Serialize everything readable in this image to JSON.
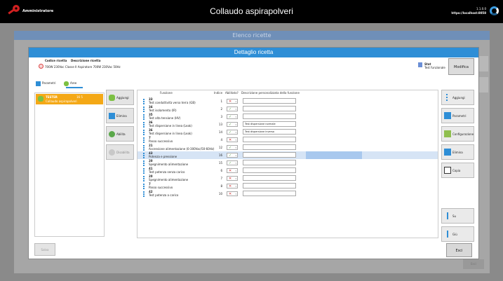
{
  "topbar": {
    "user": "Amministratore",
    "title": "Collaudo aspirapolveri",
    "version": "1.1.0.0",
    "host": "https://localhost:8058"
  },
  "background": {
    "title": "Elenco ricette",
    "footer_button": "Esci"
  },
  "dialog": {
    "title": "Dettaglio ricetta",
    "code_label": "Codice ricetta",
    "desc_label": "Descrizione ricetta",
    "recipe_value": "700W 230Vac Classe II Aspiratore 700W 230Vac 50Hz",
    "status_title": "Stat",
    "status_value": "Test funzionale",
    "modify_button": "Modifica",
    "save_button": "Salva",
    "exit_button": "Esci"
  },
  "tabs": [
    {
      "label": "Parametri"
    },
    {
      "label": "Aree"
    }
  ],
  "area": {
    "name": "TESTER",
    "meta": "16 5",
    "category": "Collaudo aspirapolveri"
  },
  "mid_buttons": [
    {
      "label": "Aggiungi"
    },
    {
      "label": "Elimina"
    },
    {
      "label": "Abilita"
    },
    {
      "label": "Disabilita"
    }
  ],
  "grid": {
    "headers": {
      "funzione": "Funzione",
      "indice": "Indice",
      "abilitato": "Abilitato?",
      "descrizione": "Descrizione personalizzata della funzione"
    },
    "rows": [
      {
        "num": "33",
        "fn": "Test conduttività verso terra (GB)",
        "idx": "1",
        "enabled": false,
        "desc": ""
      },
      {
        "num": "34",
        "fn": "Test isolamento (IR)",
        "idx": "2",
        "enabled": true,
        "desc": ""
      },
      {
        "num": "35",
        "fn": "Test alta tensione (HV)",
        "idx": "3",
        "enabled": true,
        "desc": ""
      },
      {
        "num": "36",
        "fn": "Test dispersione in linea (Leak)",
        "idx": "13",
        "enabled": true,
        "desc": "Test dispersione normale"
      },
      {
        "num": "36",
        "fn": "Test dispersione in linea (Leak)",
        "idx": "14",
        "enabled": true,
        "desc": "Test dispersione inverso"
      },
      {
        "num": "7",
        "fn": "Passo successivo",
        "idx": "4",
        "enabled": false,
        "desc": ""
      },
      {
        "num": "21",
        "fn": "Accensione alimentazione (0-300Vac/50-60Hz)",
        "idx": "12",
        "enabled": true,
        "desc": ""
      },
      {
        "num": "43",
        "fn": "Potenza e pressione",
        "idx": "16",
        "enabled": true,
        "desc": ""
      },
      {
        "num": "20",
        "fn": "Spegnimento alimentazione",
        "idx": "15",
        "enabled": true,
        "desc": ""
      },
      {
        "num": "41",
        "fn": "Test potenza senza carico",
        "idx": "6",
        "enabled": false,
        "desc": ""
      },
      {
        "num": "20",
        "fn": "Spegnimento alimentazione",
        "idx": "7",
        "enabled": false,
        "desc": ""
      },
      {
        "num": "7",
        "fn": "Passo successivo",
        "idx": "8",
        "enabled": false,
        "desc": ""
      },
      {
        "num": "42",
        "fn": "Test potenza a carico",
        "idx": "10",
        "enabled": false,
        "desc": ""
      }
    ]
  },
  "right_buttons": [
    {
      "label": "Aggiungi"
    },
    {
      "label": "Parametri"
    },
    {
      "label": "Configurazione"
    },
    {
      "label": "Elimina"
    },
    {
      "label": "Copia"
    },
    {
      "label": "Su"
    },
    {
      "label": "Giù"
    }
  ],
  "colors": {
    "accent": "#2e8ed6",
    "selected_area": "#f4a816",
    "enabled": "#5aa84a",
    "disabled": "#d03030"
  }
}
